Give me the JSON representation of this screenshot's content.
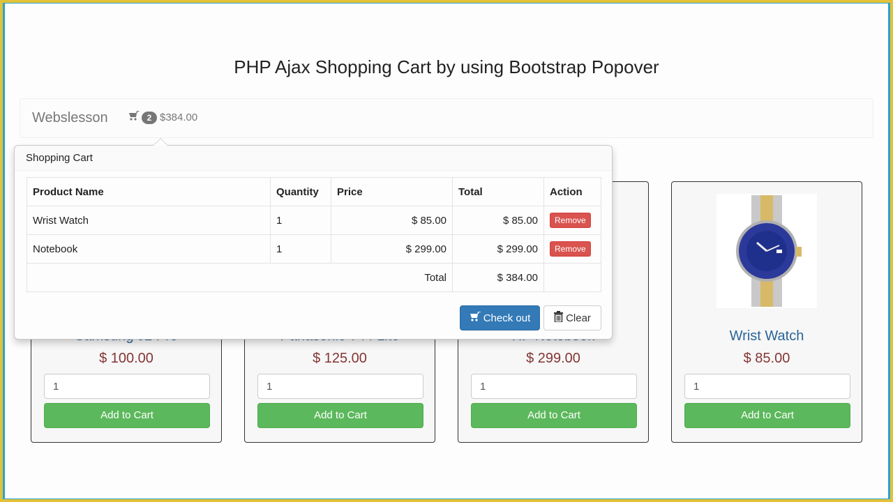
{
  "page": {
    "title": "PHP Ajax Shopping Cart by using Bootstrap Popover"
  },
  "navbar": {
    "brand": "Webslesson",
    "cart_icon": "shopping-cart-icon",
    "cart_count": "2",
    "cart_total": "$384.00"
  },
  "popover": {
    "title": "Shopping Cart",
    "columns": [
      "Product Name",
      "Quantity",
      "Price",
      "Total",
      "Action"
    ],
    "rows": [
      {
        "name": "Wrist Watch",
        "quantity": "1",
        "price": "$ 85.00",
        "total": "$ 85.00",
        "action": "Remove"
      },
      {
        "name": "Notebook",
        "quantity": "1",
        "price": "$ 299.00",
        "total": "$ 299.00",
        "action": "Remove"
      }
    ],
    "total_label": "Total",
    "total_value": "$ 384.00",
    "checkout_label": "Check out",
    "checkout_icon": "shopping-cart-icon",
    "clear_label": "Clear",
    "clear_icon": "trash-icon"
  },
  "products": [
    {
      "name": "Samsung J2 Pro",
      "price": "$ 100.00",
      "quantity": "1",
      "button": "Add to Cart"
    },
    {
      "name": "Panasonic T44 Lite",
      "price": "$ 125.00",
      "quantity": "1",
      "button": "Add to Cart"
    },
    {
      "name": "HP Notebook",
      "price": "$ 299.00",
      "quantity": "1",
      "button": "Add to Cart"
    },
    {
      "name": "Wrist Watch",
      "price": "$ 85.00",
      "quantity": "1",
      "button": "Add to Cart"
    }
  ],
  "colors": {
    "primary": "#337ab7",
    "success": "#5cb85c",
    "danger": "#d9534f",
    "price": "#843534",
    "product_name": "#2a6496"
  }
}
